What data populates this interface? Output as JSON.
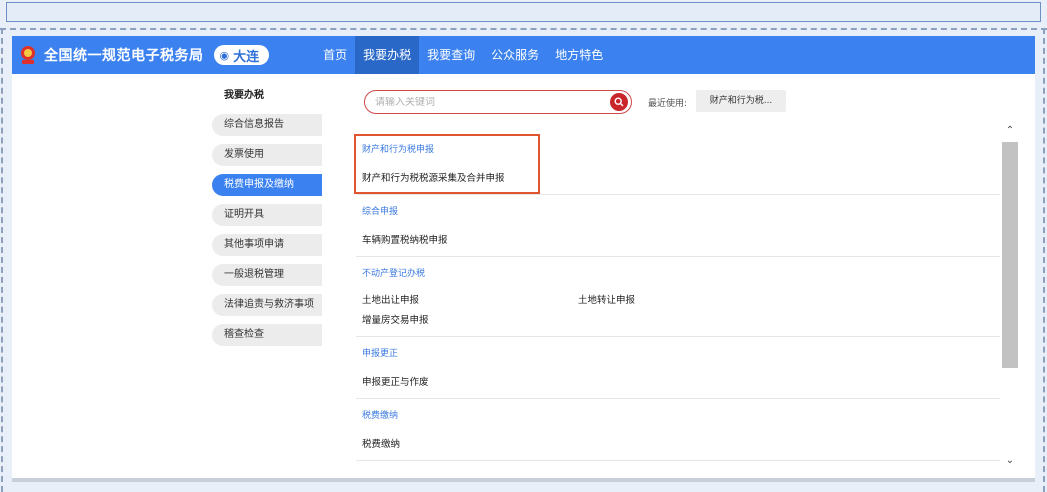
{
  "header": {
    "site_title": "全国统一规范电子税务局",
    "region": "大连",
    "nav_items": [
      {
        "label": "首页"
      },
      {
        "label": "我要办税"
      },
      {
        "label": "我要查询"
      },
      {
        "label": "公众服务"
      },
      {
        "label": "地方特色"
      }
    ],
    "active_nav": "我要办税"
  },
  "sidebar": {
    "title": "我要办税",
    "items": [
      {
        "label": "综合信息报告"
      },
      {
        "label": "发票使用"
      },
      {
        "label": "税费申报及缴纳"
      },
      {
        "label": "证明开具"
      },
      {
        "label": "其他事项申请"
      },
      {
        "label": "一般退税管理"
      },
      {
        "label": "法律追责与救济事项"
      },
      {
        "label": "稽查检查"
      }
    ],
    "active_item": "税费申报及缴纳"
  },
  "search": {
    "placeholder": "请输入关键词",
    "recent_label": "最近使用:",
    "recent_chip": "财产和行为税..."
  },
  "sections": [
    {
      "header": "财产和行为税申报",
      "items": [
        "财产和行为税税源采集及合并申报"
      ]
    },
    {
      "header": "综合申报",
      "items": [
        "车辆购置税纳税申报"
      ]
    },
    {
      "header": "不动产登记办税",
      "items": [
        "土地出让申报",
        "土地转让申报",
        "增量房交易申报"
      ]
    },
    {
      "header": "申报更正",
      "items": [
        "申报更正与作废"
      ]
    },
    {
      "header": "税费缴纳",
      "items": [
        "税费缴纳"
      ]
    }
  ],
  "colors": {
    "nav_blue": "#3b82f0",
    "section_blue": "#3b7ae0",
    "highlight_box": "#e0542f",
    "search_red": "#c9262c"
  }
}
